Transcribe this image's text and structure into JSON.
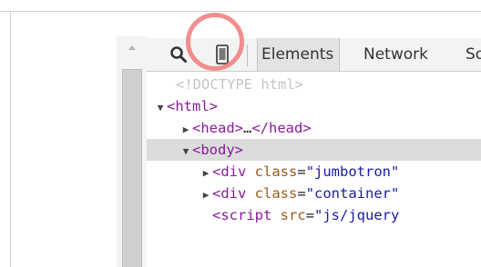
{
  "toolbar": {
    "search_icon": "magnifier-icon",
    "device_icon": "mobile-device-icon",
    "tabs": [
      {
        "label": "Elements"
      },
      {
        "label": "Network"
      },
      {
        "label": "So"
      }
    ]
  },
  "dom_tree": {
    "lines": [
      {
        "text": "<!DOCTYPE html>"
      },
      {
        "arrow": "▼",
        "tag": "<html>"
      },
      {
        "arrow": "▶",
        "tag_open": "<head>",
        "ellipsis": "…",
        "tag_close": "</head>"
      },
      {
        "arrow": "▼",
        "tag": "<body>"
      },
      {
        "arrow": "▶",
        "tag_open": "<div",
        "attr": "class",
        "eq": "=",
        "value": "\"jumbotron\""
      },
      {
        "arrow": "▶",
        "tag_open": "<div",
        "attr": "class",
        "eq": "=",
        "value": "\"container\""
      },
      {
        "tag_open": "<script",
        "attr": "src",
        "eq": "=",
        "value": "\"js/jquery"
      }
    ]
  },
  "colors": {
    "highlight": "#f07a7a",
    "selected_row": "#dcdcdc",
    "tag": "#8a1a9b",
    "attr_name": "#9b5a1a",
    "attr_value": "#1a1aa6"
  }
}
